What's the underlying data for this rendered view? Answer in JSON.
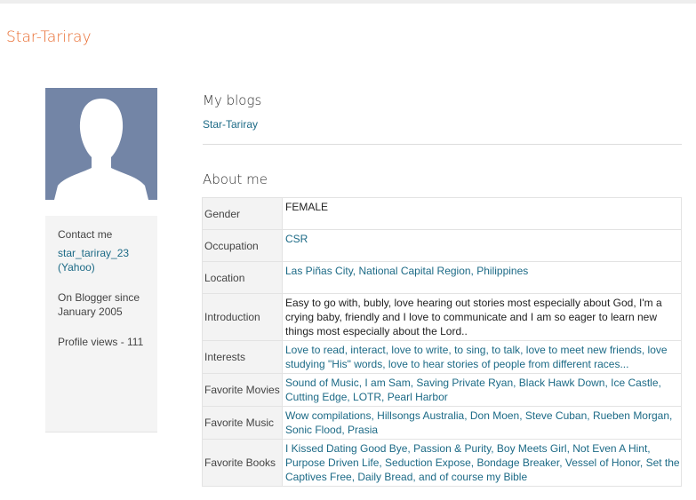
{
  "header": {
    "site_title": "Star-Tariray"
  },
  "profile": {
    "avatar_alt": "profile-photo",
    "contact": {
      "label": "Contact me",
      "link": "star_tariray_23 (Yahoo)"
    },
    "since": "On Blogger since January 2005",
    "views": "Profile views - 111"
  },
  "blogs": {
    "heading": "My blogs",
    "items": [
      "Star-Tariray"
    ]
  },
  "about": {
    "heading": "About me",
    "rows": [
      {
        "label": "Gender",
        "value": "FEMALE"
      },
      {
        "label": "Occupation",
        "value": "CSR"
      },
      {
        "label": "Location",
        "value": "Las Piñas City, National Capital Region, Philippines"
      },
      {
        "label": "Introduction",
        "value": "Easy to go with, bubly, love hearing out stories most especially about God, I'm a crying baby, friendly and I love to communicate and I am so eager to learn new things most especially about the Lord.."
      },
      {
        "label": "Interests",
        "value": "Love to read, interact, love to write, to sing, to talk, love to meet new friends, love studying \"His\" words, love to hear stories of people from different races..."
      },
      {
        "label": "Favorite Movies",
        "value": "Sound of Music, I am Sam, Saving Private Ryan, Black Hawk Down, Ice Castle, Cutting Edge, LOTR, Pearl Harbor"
      },
      {
        "label": "Favorite Music",
        "value": "Wow compilations, Hillsongs Australia, Don Moen, Steve Cuban, Rueben Morgan, Sonic Flood, Prasia"
      },
      {
        "label": "Favorite Books",
        "value": "I Kissed Dating Good Bye, Passion & Purity, Boy Meets Girl, Not Even A Hint, Purpose Driven Life, Seduction Expose, Bondage Breaker, Vessel of Honor, Set the Captives Free, Daily Bread, and of course my Bible"
      }
    ]
  },
  "colors": {
    "title_accent": "#e8692c",
    "link": "#1c6a86",
    "avatar_bg": "#7385a6"
  }
}
